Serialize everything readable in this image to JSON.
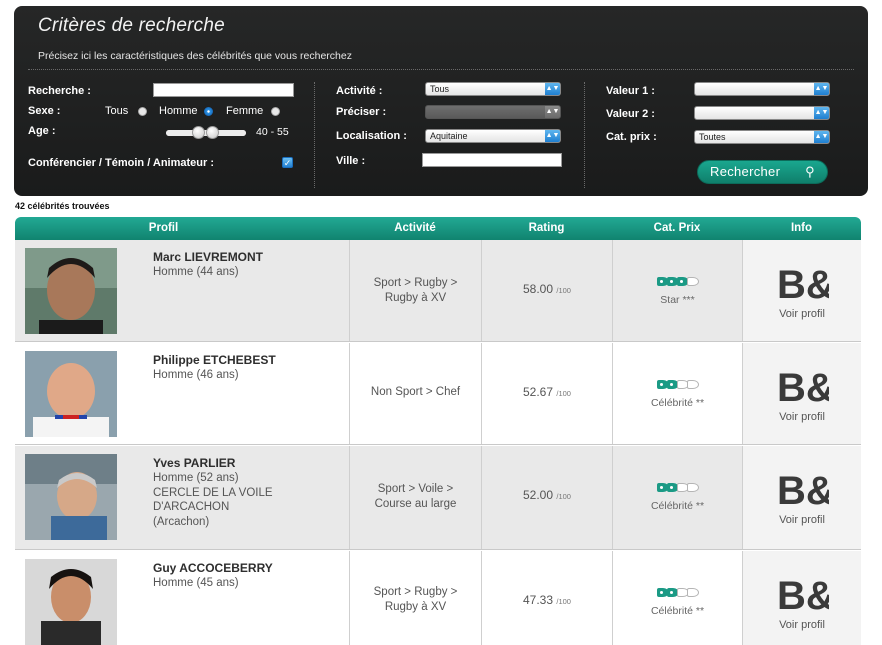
{
  "search_panel": {
    "title": "Critères de recherche",
    "subtitle": "Précisez ici les caractéristiques des célébrités que vous recherchez",
    "col1": {
      "recherche_label": "Recherche :",
      "recherche_value": "",
      "sexe_label": "Sexe :",
      "sexe_options": [
        "Tous",
        "Homme",
        "Femme"
      ],
      "sexe_selected": "Homme",
      "age_label": "Age :",
      "age_range_text": "40 - 55",
      "age_min": 40,
      "age_max": 55,
      "conferencier_label": "Conférencier / Témoin / Animateur :",
      "conferencier_checked": true
    },
    "col2": {
      "activite_label": "Activité :",
      "activite_value": "Tous",
      "preciser_label": "Préciser :",
      "preciser_value": "",
      "localisation_label": "Localisation :",
      "localisation_value": "Aquitaine",
      "ville_label": "Ville :",
      "ville_value": ""
    },
    "col3": {
      "valeur1_label": "Valeur 1 :",
      "valeur1_value": "",
      "valeur2_label": "Valeur 2 :",
      "valeur2_value": "",
      "catprix_label": "Cat. prix :",
      "catprix_value": "Toutes",
      "search_button": "Rechercher"
    }
  },
  "results_count": "42 célébrités trouvées",
  "table": {
    "headers": [
      "Profil",
      "Activité",
      "Rating",
      "Cat. Prix",
      "Info"
    ],
    "rows": [
      {
        "name": "Marc LIEVREMONT",
        "detail": "Homme (44 ans)",
        "activity": "Sport > Rugby > Rugby à XV",
        "rating": "58.00",
        "rating_unit": "/100",
        "tags_filled": 3,
        "tags_total": 4,
        "category": "Star ***",
        "info_logo": "B&C",
        "info_link": "Voir profil"
      },
      {
        "name": "Philippe ETCHEBEST",
        "detail": "Homme (46 ans)",
        "activity": "Non Sport > Chef",
        "rating": "52.67",
        "rating_unit": "/100",
        "tags_filled": 2,
        "tags_total": 4,
        "category": "Célébrité **",
        "info_logo": "B&C",
        "info_link": "Voir profil"
      },
      {
        "name": "Yves PARLIER",
        "detail": "Homme (52 ans) CERCLE DE LA VOILE D'ARCACHON (Arcachon)",
        "activity": "Sport > Voile > Course au large",
        "rating": "52.00",
        "rating_unit": "/100",
        "tags_filled": 2,
        "tags_total": 4,
        "category": "Célébrité **",
        "info_logo": "B&C",
        "info_link": "Voir profil"
      },
      {
        "name": "Guy ACCOCEBERRY",
        "detail": "Homme (45 ans)",
        "activity": "Sport > Rugby > Rugby à XV",
        "rating": "47.33",
        "rating_unit": "/100",
        "tags_filled": 2,
        "tags_total": 4,
        "category": "Célébrité **",
        "info_logo": "B&C",
        "info_link": "Voir profil"
      }
    ]
  },
  "colors": {
    "accent": "#14957f",
    "panel": "#1f2020",
    "row_alt": "#e9e9e9"
  }
}
